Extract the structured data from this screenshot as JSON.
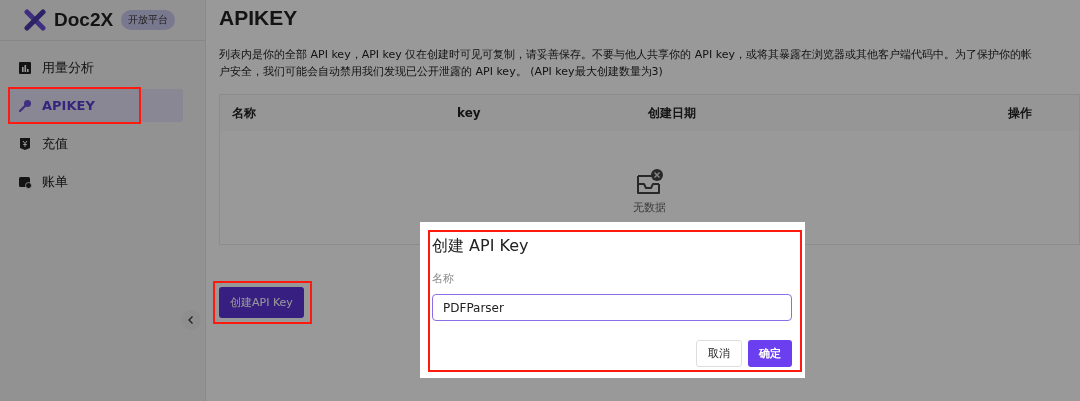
{
  "brand": {
    "name": "Doc2X",
    "badge": "开放平台"
  },
  "sidebar": {
    "items": [
      {
        "label": "用量分析",
        "kind": "chart",
        "selected": false,
        "highlighted": false
      },
      {
        "label": "APIKEY",
        "kind": "key",
        "selected": true,
        "highlighted": true
      },
      {
        "label": "充值",
        "kind": "recharge",
        "selected": false,
        "highlighted": false
      },
      {
        "label": "账单",
        "kind": "bill",
        "selected": false,
        "highlighted": false
      }
    ]
  },
  "page": {
    "title": "APIKEY",
    "description": "列表内是你的全部 API key，API key 仅在创建时可见可复制，请妥善保存。不要与他人共享你的 API key，或将其暴露在浏览器或其他客户端代码中。为了保护你的帐户安全，我们可能会自动禁用我们发现已公开泄露的 API key。 (API key最大创建数量为3)"
  },
  "table": {
    "columns": [
      "名称",
      "key",
      "创建日期",
      "操作"
    ],
    "empty_text": "无数据"
  },
  "create_button": {
    "label": "创建API Key",
    "highlighted": true
  },
  "dialog": {
    "title": "创建 API Key",
    "field_label": "名称",
    "value": "PDFParser",
    "highlighted": true,
    "buttons": [
      {
        "label": "取消",
        "kind": "secondary"
      },
      {
        "label": "确定",
        "kind": "primary"
      }
    ]
  }
}
